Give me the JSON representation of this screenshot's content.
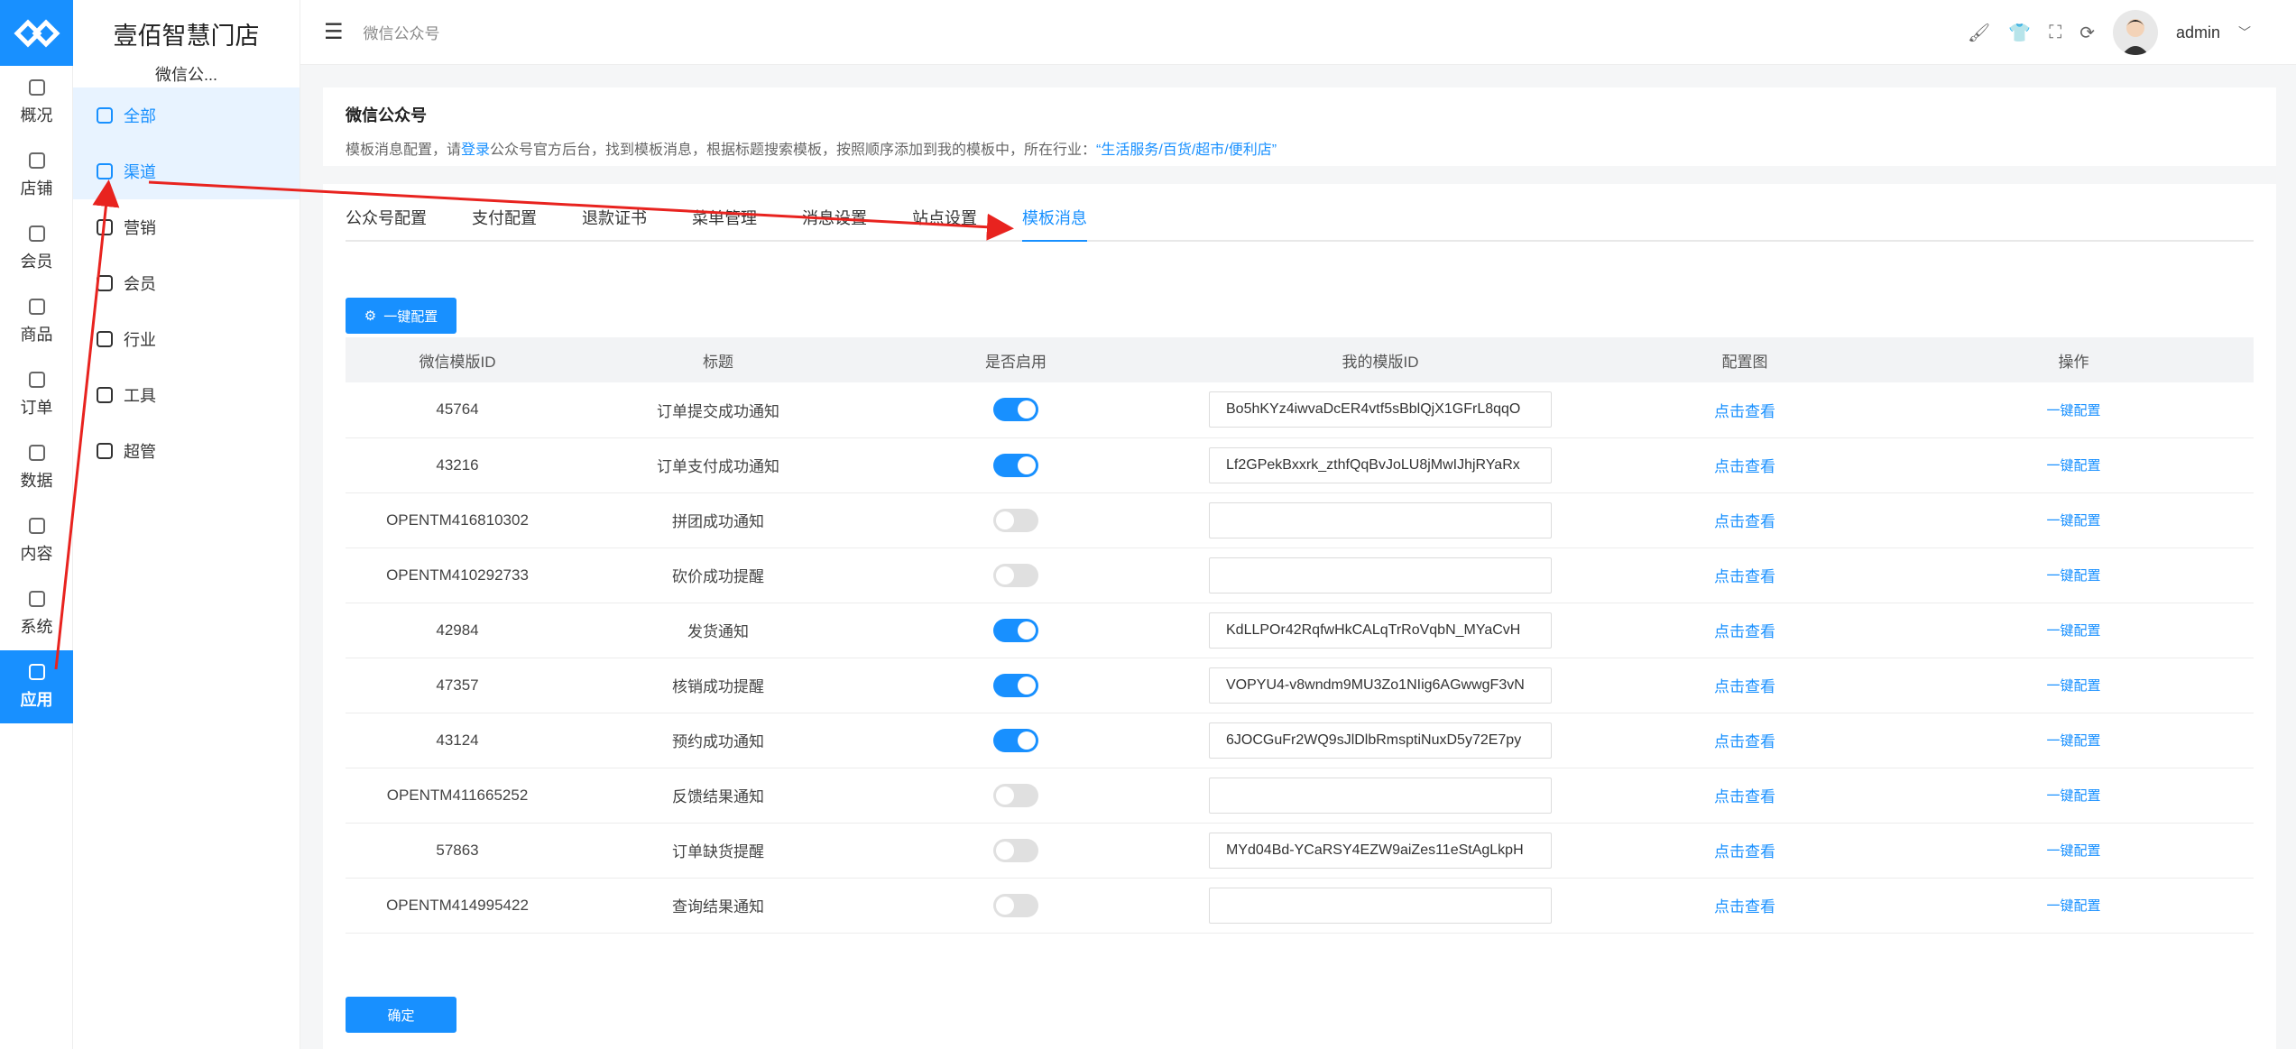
{
  "app": {
    "title": "壹佰智慧门店",
    "subtitle": "微信公..."
  },
  "rail": [
    {
      "label": "概况",
      "icon": "dashboard-icon"
    },
    {
      "label": "店铺",
      "icon": "store-icon"
    },
    {
      "label": "会员",
      "icon": "user-icon"
    },
    {
      "label": "商品",
      "icon": "box-icon"
    },
    {
      "label": "订单",
      "icon": "order-icon"
    },
    {
      "label": "数据",
      "icon": "chart-icon"
    },
    {
      "label": "内容",
      "icon": "folder-icon"
    },
    {
      "label": "系统",
      "icon": "gear-icon"
    },
    {
      "label": "应用",
      "icon": "app-icon"
    }
  ],
  "submenu": [
    {
      "label": "全部",
      "icon": "cube-icon"
    },
    {
      "label": "渠道",
      "icon": "channel-icon"
    },
    {
      "label": "营销",
      "icon": "marketing-icon"
    },
    {
      "label": "会员",
      "icon": "member-icon"
    },
    {
      "label": "行业",
      "icon": "industry-icon"
    },
    {
      "label": "工具",
      "icon": "wrench-icon"
    },
    {
      "label": "超管",
      "icon": "admin-icon"
    }
  ],
  "topbar": {
    "breadcrumb": "微信公众号",
    "user": "admin"
  },
  "intro": {
    "title": "微信公众号",
    "desc_1": "模板消息配置，请",
    "login_link": "登录",
    "desc_2": "公众号官方后台，找到模板消息，根据标题搜索模板，按照顺序添加到我的模板中，所在行业：",
    "industry_link": "“生活服务/百货/超市/便利店”"
  },
  "tabs": [
    "公众号配置",
    "支付配置",
    "退款证书",
    "菜单管理",
    "消息设置",
    "站点设置",
    "模板消息"
  ],
  "buttons": {
    "quick_config": "一键配置",
    "confirm": "确定"
  },
  "table": {
    "headers": [
      "微信模版ID",
      "标题",
      "是否启用",
      "我的模版ID",
      "配置图",
      "操作"
    ],
    "view_link": "点击查看",
    "action_link": "一键配置",
    "rows": [
      {
        "id": "45764",
        "title": "订单提交成功通知",
        "enabled": true,
        "my_id": "Bo5hKYz4iwvaDcER4vtf5sBblQjX1GFrL8qqO"
      },
      {
        "id": "43216",
        "title": "订单支付成功通知",
        "enabled": true,
        "my_id": "Lf2GPekBxxrk_zthfQqBvJoLU8jMwIJhjRYaRx"
      },
      {
        "id": "OPENTM416810302",
        "title": "拼团成功通知",
        "enabled": false,
        "my_id": ""
      },
      {
        "id": "OPENTM410292733",
        "title": "砍价成功提醒",
        "enabled": false,
        "my_id": ""
      },
      {
        "id": "42984",
        "title": "发货通知",
        "enabled": true,
        "my_id": "KdLLPOr42RqfwHkCALqTrRoVqbN_MYaCvH"
      },
      {
        "id": "47357",
        "title": "核销成功提醒",
        "enabled": true,
        "my_id": "VOPYU4-v8wndm9MU3Zo1NIig6AGwwgF3vN"
      },
      {
        "id": "43124",
        "title": "预约成功通知",
        "enabled": true,
        "my_id": "6JOCGuFr2WQ9sJlDlbRmsptiNuxD5y72E7py"
      },
      {
        "id": "OPENTM411665252",
        "title": "反馈结果通知",
        "enabled": false,
        "my_id": ""
      },
      {
        "id": "57863",
        "title": "订单缺货提醒",
        "enabled": false,
        "my_id": "MYd04Bd-YCaRSY4EZW9aiZes11eStAgLkpH"
      },
      {
        "id": "OPENTM414995422",
        "title": "查询结果通知",
        "enabled": false,
        "my_id": ""
      }
    ]
  },
  "colors": {
    "primary": "#1890ff",
    "annotation": "#e8231f"
  }
}
